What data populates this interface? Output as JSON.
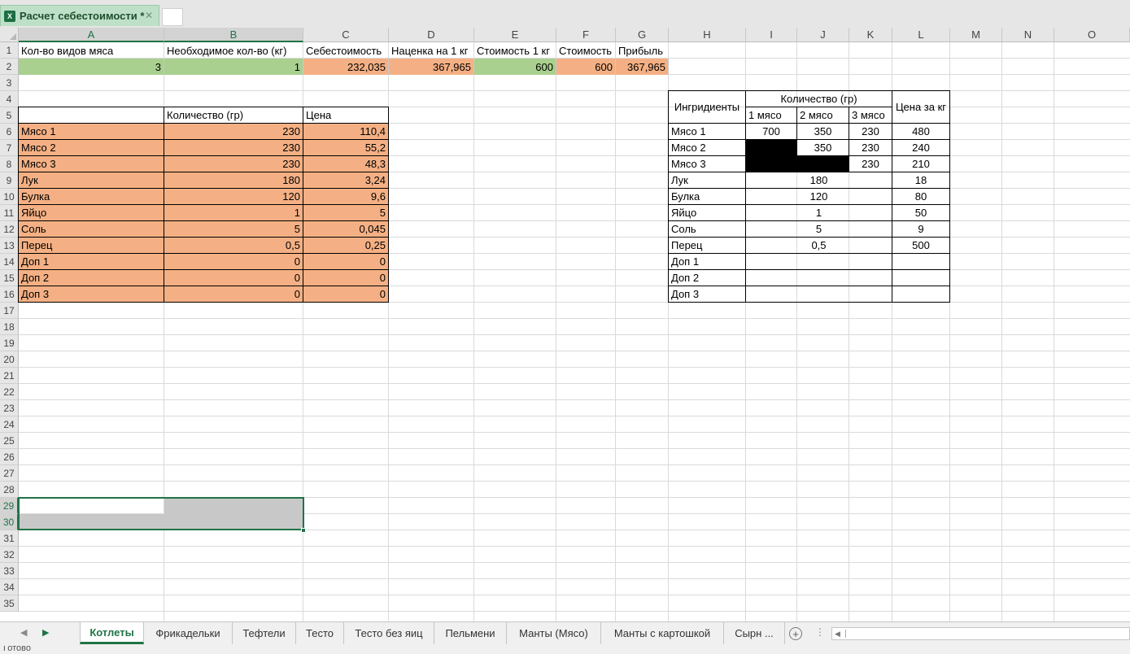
{
  "window": {
    "doc_tab_title": "Расчет себестоимости *",
    "doc_tab_close": "✕",
    "app_icon": "X"
  },
  "columns": [
    "A",
    "B",
    "C",
    "D",
    "E",
    "F",
    "G",
    "H",
    "I",
    "J",
    "K",
    "L",
    "M",
    "N",
    "O"
  ],
  "rows": [
    "1",
    "2",
    "3",
    "4",
    "5",
    "6",
    "7",
    "8",
    "9",
    "10",
    "11",
    "12",
    "13",
    "14",
    "15",
    "16",
    "17",
    "18",
    "19",
    "20",
    "21",
    "22",
    "23",
    "24",
    "25",
    "26",
    "27",
    "28",
    "29",
    "30",
    "31",
    "32",
    "33",
    "34",
    "35"
  ],
  "selected_cells": {
    "columns": [
      "A",
      "B"
    ],
    "rows": [
      "29",
      "30"
    ]
  },
  "header_row": {
    "labels": [
      "Кол-во видов мяса",
      "Необходимое кол-во (кг)",
      "Себестоимость",
      "Наценка на 1 кг",
      "Стоимость 1 кг",
      "Стоимость",
      "Прибыль"
    ],
    "values": [
      "3",
      "1",
      "232,035",
      "367,965",
      "600",
      "600",
      "367,965"
    ]
  },
  "cost_table": {
    "headers": [
      "",
      "Количество (гр)",
      "Цена"
    ],
    "rows": [
      [
        "Мясо 1",
        "230",
        "110,4"
      ],
      [
        "Мясо 2",
        "230",
        "55,2"
      ],
      [
        "Мясо 3",
        "230",
        "48,3"
      ],
      [
        "Лук",
        "180",
        "3,24"
      ],
      [
        "Булка",
        "120",
        "9,6"
      ],
      [
        "Яйцо",
        "1",
        "5"
      ],
      [
        "Соль",
        "5",
        "0,045"
      ],
      [
        "Перец",
        "0,5",
        "0,25"
      ],
      [
        "Доп 1",
        "0",
        "0"
      ],
      [
        "Доп 2",
        "0",
        "0"
      ],
      [
        "Доп 3",
        "0",
        "0"
      ]
    ]
  },
  "ingredients_table": {
    "header_ingredients": "Ингридиенты",
    "header_quantity": "Количество (гр)",
    "header_price": "Цена за кг",
    "sub_headers": [
      "1 мясо",
      "2 мясо",
      "3 мясо"
    ],
    "meat_rows": [
      {
        "name": "Мясо 1",
        "q1": "700",
        "q2": "350",
        "q3": "230",
        "price": "480"
      },
      {
        "name": "Мясо 2",
        "q1": "",
        "q2": "350",
        "q3": "230",
        "price": "240"
      },
      {
        "name": "Мясо 3",
        "q1": "",
        "q2": "",
        "q3": "230",
        "price": "210"
      }
    ],
    "other_rows": [
      {
        "name": "Лук",
        "qty": "180",
        "price": "18"
      },
      {
        "name": "Булка",
        "qty": "120",
        "price": "80"
      },
      {
        "name": "Яйцо",
        "qty": "1",
        "price": "50"
      },
      {
        "name": "Соль",
        "qty": "5",
        "price": "9"
      },
      {
        "name": "Перец",
        "qty": "0,5",
        "price": "500"
      },
      {
        "name": "Доп 1",
        "qty": "",
        "price": ""
      },
      {
        "name": "Доп 2",
        "qty": "",
        "price": ""
      },
      {
        "name": "Доп 3",
        "qty": "",
        "price": ""
      }
    ]
  },
  "sheet_tabs": [
    "Котлеты",
    "Фрикадельки",
    "Тефтели",
    "Тесто",
    "Тесто без яиц",
    "Пельмени",
    "Манты (Мясо)",
    "Манты с картошкой",
    "Сырн ..."
  ],
  "active_sheet": "Котлеты",
  "status": {
    "text": "Готово"
  },
  "colors": {
    "green_fill": "#a9d08e",
    "orange_fill": "#f4b084",
    "excel_green": "#217346",
    "selection_gray": "#c8c8c8"
  }
}
